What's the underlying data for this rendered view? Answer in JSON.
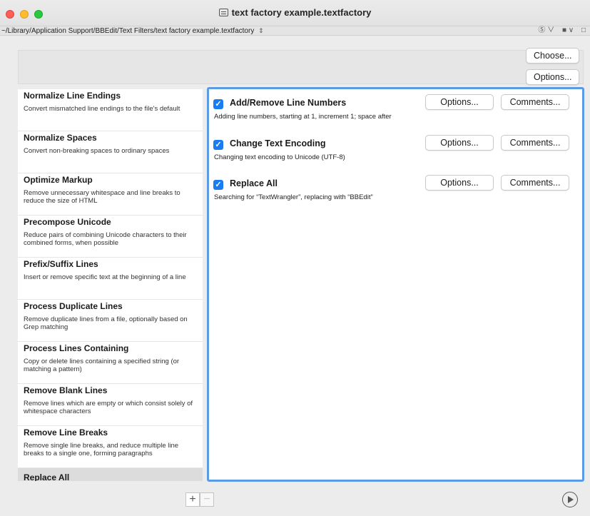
{
  "window": {
    "title": "text factory example.textfactory",
    "path": "~/Library/Application Support/BBEdit/Text Filters/text factory example.textfactory",
    "path_updown": "⇕",
    "toolbar_right": [
      "Ⓢ ∨",
      "■ ∨",
      "□"
    ]
  },
  "top_buttons": {
    "choose": "Choose...",
    "options": "Options..."
  },
  "left_list": [
    {
      "name": "Normalize Line Endings",
      "desc": "Convert mismatched line endings to the file's default"
    },
    {
      "name": "Normalize Spaces",
      "desc": "Convert non-breaking spaces to ordinary spaces"
    },
    {
      "name": "Optimize Markup",
      "desc": "Remove unnecessary whitespace and line breaks to reduce the size of HTML"
    },
    {
      "name": "Precompose Unicode",
      "desc": "Reduce pairs of combining Unicode characters to their combined forms, when possible"
    },
    {
      "name": "Prefix/Suffix Lines",
      "desc": "Insert or remove specific text at the beginning of a line"
    },
    {
      "name": "Process Duplicate Lines",
      "desc": "Remove duplicate lines from a file, optionally based on Grep matching"
    },
    {
      "name": "Process Lines Containing",
      "desc": "Copy or delete lines containing a specified string (or matching a pattern)"
    },
    {
      "name": "Remove Blank Lines",
      "desc": "Remove lines which are empty or which consist solely of whitespace characters"
    },
    {
      "name": "Remove Line Breaks",
      "desc": "Remove single line breaks, and reduce multiple line breaks to a single one, forming paragraphs"
    },
    {
      "name": "Replace All",
      "desc": ""
    }
  ],
  "steps": [
    {
      "name": "Add/Remove Line Numbers",
      "desc": "Adding line numbers, starting at 1, increment 1; space after",
      "options": "Options...",
      "comments": "Comments..."
    },
    {
      "name": "Change Text Encoding",
      "desc": "Changing text encoding to Unicode (UTF-8)",
      "options": "Options...",
      "comments": "Comments..."
    },
    {
      "name": "Replace All",
      "desc": "Searching for “TextWrangler”, replacing with “BBEdit”",
      "options": "Options...",
      "comments": "Comments..."
    }
  ],
  "bottom": {
    "plus": "+",
    "minus": "−"
  },
  "colors": {
    "accent": "#1a7cf2",
    "panel_border": "#5b9ae4"
  }
}
